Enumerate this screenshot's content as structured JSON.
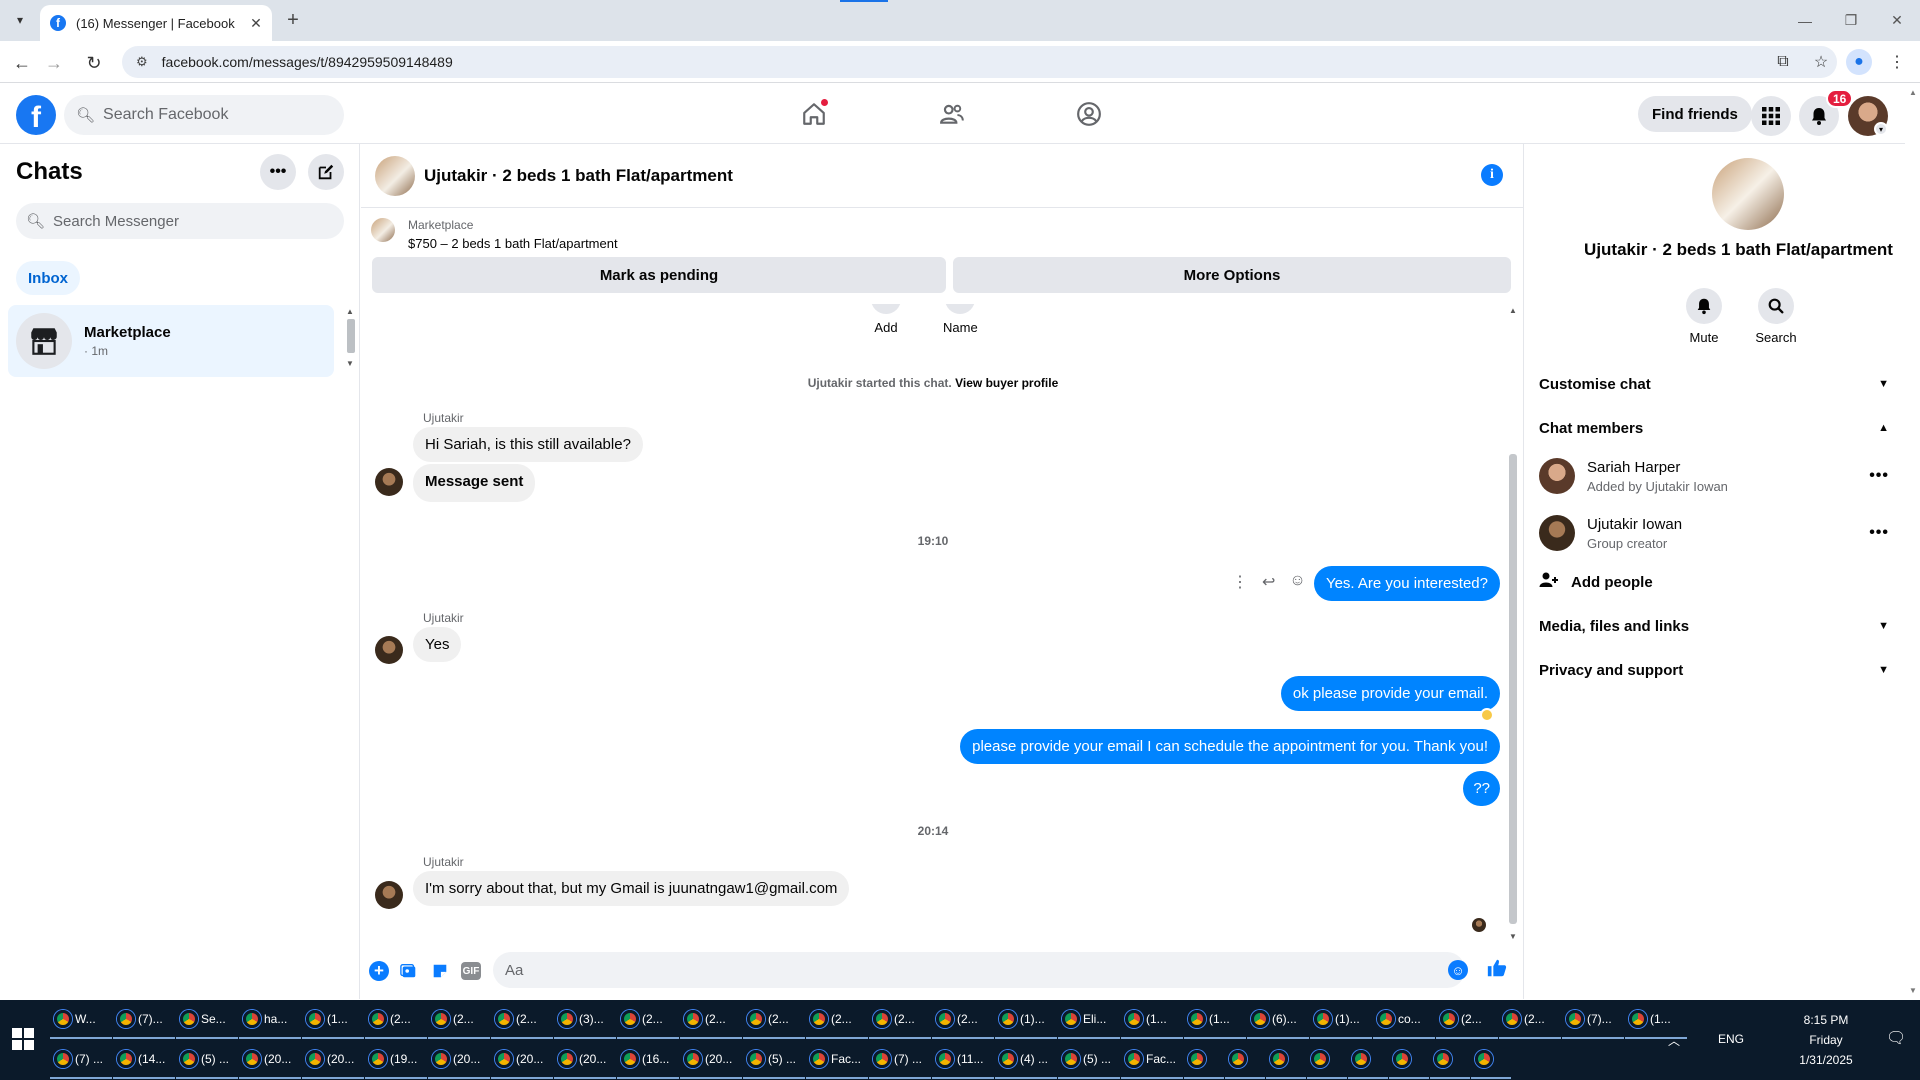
{
  "browser": {
    "tab_title": "(16) Messenger | Facebook",
    "url": "facebook.com/messages/t/8942959509148489"
  },
  "fb_header": {
    "logo_letter": "f",
    "search_placeholder": "Search Facebook",
    "find_friends_label": "Find friends",
    "notification_count": "16"
  },
  "sidebar": {
    "title": "Chats",
    "search_placeholder": "Search Messenger",
    "filter_label": "Inbox",
    "chats": [
      {
        "name": "Marketplace",
        "time": "· 1m"
      }
    ]
  },
  "conversation": {
    "title": "Ujutakir · 2 beds 1 bath Flat/apartment",
    "listing_label": "Marketplace",
    "listing_title": "$750 – 2 beds 1 bath Flat/apartment",
    "mark_pending_label": "Mark as pending",
    "more_options_label": "More Options",
    "top_actions": [
      "Add",
      "Name"
    ],
    "started_text": "Ujutakir started this chat.",
    "view_profile_label": "View buyer profile",
    "messages": [
      {
        "sender": "Ujutakir",
        "text": "Hi Sariah, is this still available?"
      },
      {
        "text": "Message sent"
      },
      {
        "timestamp": "19:10"
      },
      {
        "outgoing": "Yes. Are you interested?"
      },
      {
        "sender": "Ujutakir",
        "text": "Yes"
      },
      {
        "outgoing": "ok please provide your email."
      },
      {
        "outgoing": "please provide your email  I can  schedule the appointment for you. Thank you!"
      },
      {
        "outgoing": "??"
      },
      {
        "timestamp": "20:14"
      },
      {
        "sender": "Ujutakir",
        "text": "I'm sorry about that, but my Gmail is juunatngaw1@gmail.com"
      }
    ],
    "composer_placeholder": "Aa",
    "gif_label": "GIF"
  },
  "right_panel": {
    "title": "Ujutakir · 2 beds 1 bath Flat/apartment",
    "mute_label": "Mute",
    "search_label": "Search",
    "sections": {
      "customise": "Customise chat",
      "members": "Chat members",
      "media": "Media, files and links",
      "privacy": "Privacy and support"
    },
    "members": [
      {
        "name": "Sariah Harper",
        "sub": "Added by Ujutakir Iowan"
      },
      {
        "name": "Ujutakir Iowan",
        "sub": "Group creator"
      }
    ],
    "add_people_label": "Add people"
  },
  "taskbar": {
    "row1": [
      "W...",
      "(7)...",
      "Se...",
      "ha...",
      "(1...",
      "(2...",
      "(2...",
      "(2...",
      "(3)...",
      "(2...",
      "(2...",
      "(2...",
      "(2...",
      "(2...",
      "(2...",
      "(1)...",
      "Eli...",
      "(1...",
      "(1...",
      "(6)...",
      "(1)...",
      "co...",
      "(2...",
      "(2...",
      "(7)...",
      "(1..."
    ],
    "row2": [
      "(7) ...",
      "(14...",
      "(5) ...",
      "(20...",
      "(20...",
      "(19...",
      "(20...",
      "(20...",
      "(20...",
      "(16...",
      "(20...",
      "(5) ...",
      "Fac...",
      "(7) ...",
      "(11...",
      "(4) ...",
      "(5) ...",
      "Fac...",
      "",
      "",
      "",
      "",
      "",
      "",
      "",
      ""
    ],
    "language": "ENG",
    "time": "8:15 PM",
    "day": "Friday",
    "date": "1/31/2025"
  },
  "colors": {
    "brand_blue": "#1877f2",
    "outgoing_bubble": "#0084ff",
    "badge_red": "#e41e3f"
  }
}
